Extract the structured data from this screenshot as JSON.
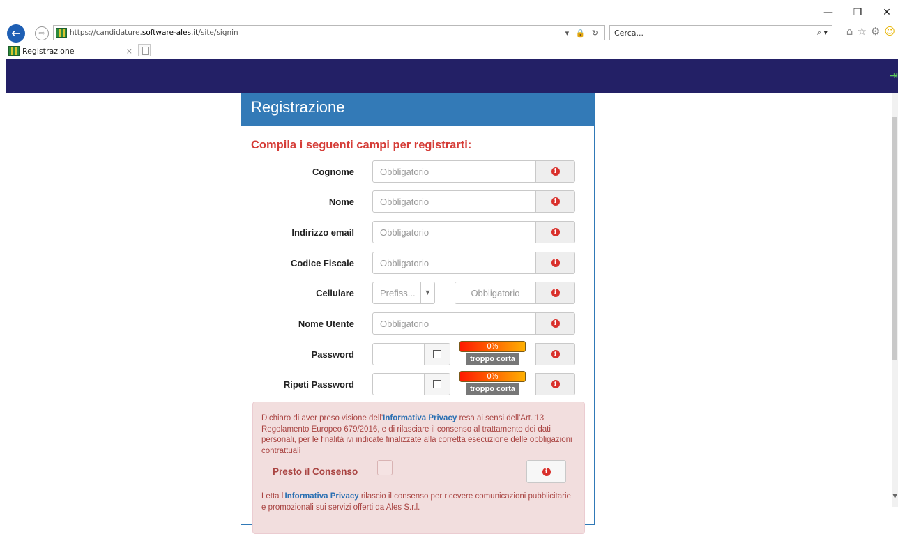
{
  "browser": {
    "url_prefix": "https://candidature.",
    "url_domain": "software-ales.it",
    "url_path": "/site/signin",
    "addr_tools": "▾ 🔒 ↻",
    "search_placeholder": "Cerca...",
    "search_icon": "⌕ ▾",
    "tab_title": "Registrazione",
    "tab_close": "×",
    "win_minimize": "—",
    "win_restore": "❐",
    "win_close": "✕",
    "icons": {
      "back": "←",
      "forward": "⇨",
      "home": "⌂",
      "favorites": "☆",
      "settings": "⚙",
      "feedback": "☺"
    }
  },
  "header": {
    "login_icon": "⇥"
  },
  "panel": {
    "title": "Registrazione",
    "subtitle": "Compila i seguenti campi per registrarti:"
  },
  "form": {
    "cognome": {
      "label": "Cognome",
      "placeholder": "Obbligatorio"
    },
    "nome": {
      "label": "Nome",
      "placeholder": "Obbligatorio"
    },
    "email": {
      "label": "Indirizzo email",
      "placeholder": "Obbligatorio"
    },
    "codice_fiscale": {
      "label": "Codice Fiscale",
      "placeholder": "Obbligatorio"
    },
    "cellulare": {
      "label": "Cellulare",
      "prefix_placeholder": "Prefiss...",
      "placeholder": "Obbligatorio"
    },
    "nome_utente": {
      "label": "Nome Utente",
      "placeholder": "Obbligatorio"
    },
    "password": {
      "label": "Password",
      "strength_percent": "0%",
      "strength_label": "troppo corta",
      "strength_fraction": 0
    },
    "ripeti_password": {
      "label": "Ripeti Password",
      "strength_percent": "0%",
      "strength_label": "troppo corta",
      "strength_fraction": 0
    }
  },
  "privacy": {
    "text1_before": "Dichiaro di aver preso visione dell'",
    "text1_link": "Informativa Privacy",
    "text1_after": " resa ai sensi dell'Art. 13 Regolamento Europeo 679/2016, e di rilasciare il consenso al trattamento dei dati personali, per le finalità ivi indicate finalizzate alla corretta esecuzione delle obbligazioni contrattuali",
    "consent_label": "Presto il Consenso",
    "text2_before": "Letta l'",
    "text2_link": "Informativa Privacy",
    "text2_after": " rilascio il consenso per ricevere comunicazioni pubblicitarie e promozionali sui servizi offerti da Ales S.r.l."
  },
  "colors": {
    "navbar": "#232066",
    "panel_header": "#337ab7",
    "subtitle": "#d53c37",
    "alert_bg": "#f2dede",
    "alert_text": "#a94442",
    "info_icon": "#d9312c"
  }
}
